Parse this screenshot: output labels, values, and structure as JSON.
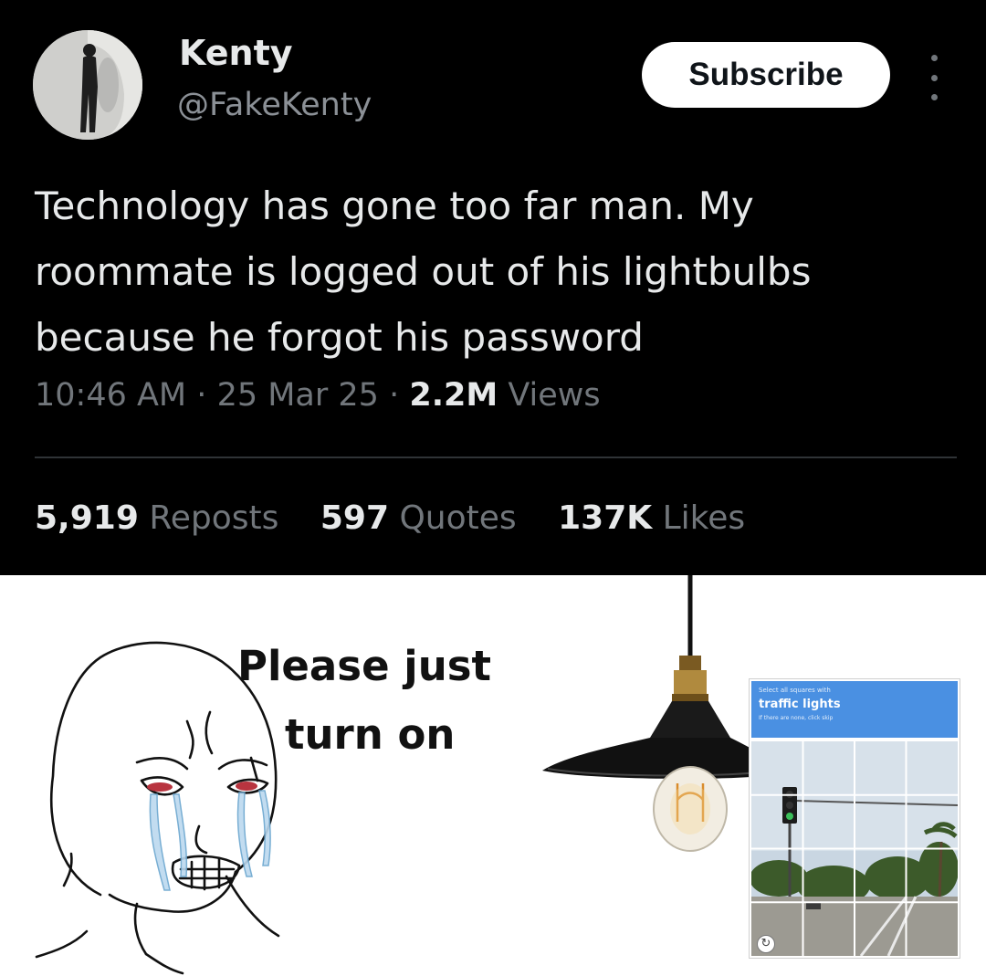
{
  "tweet": {
    "display_name": "Kenty",
    "handle": "@FakeKenty",
    "subscribe_label": "Subscribe",
    "more_icon": "more-dots-icon",
    "text_lines": [
      "Technology has gone too far man. My",
      "roommate is logged out of his lightbulbs",
      "because he forgot his password"
    ],
    "time": "10:46 AM",
    "separator": "·",
    "date": "25 Mar 25",
    "views_count": "2.2M",
    "views_label": "Views",
    "stats": {
      "reposts_count": "5,919",
      "reposts_label": "Reposts",
      "quotes_count": "597",
      "quotes_label": "Quotes",
      "likes_count": "137K",
      "likes_label": "Likes"
    }
  },
  "meme": {
    "caption_lines": [
      "Please just",
      "turn on"
    ],
    "captcha": {
      "instruction": "Select all squares with",
      "target": "traffic lights",
      "subtext": "If there are none, click skip",
      "reload_icon": "reload-icon"
    }
  },
  "colors": {
    "tweet_background": "#000000",
    "text_primary": "#e7e9ea",
    "text_secondary": "#71767b",
    "subscribe_background": "#ffffff",
    "captcha_blue": "#4a90e2"
  }
}
